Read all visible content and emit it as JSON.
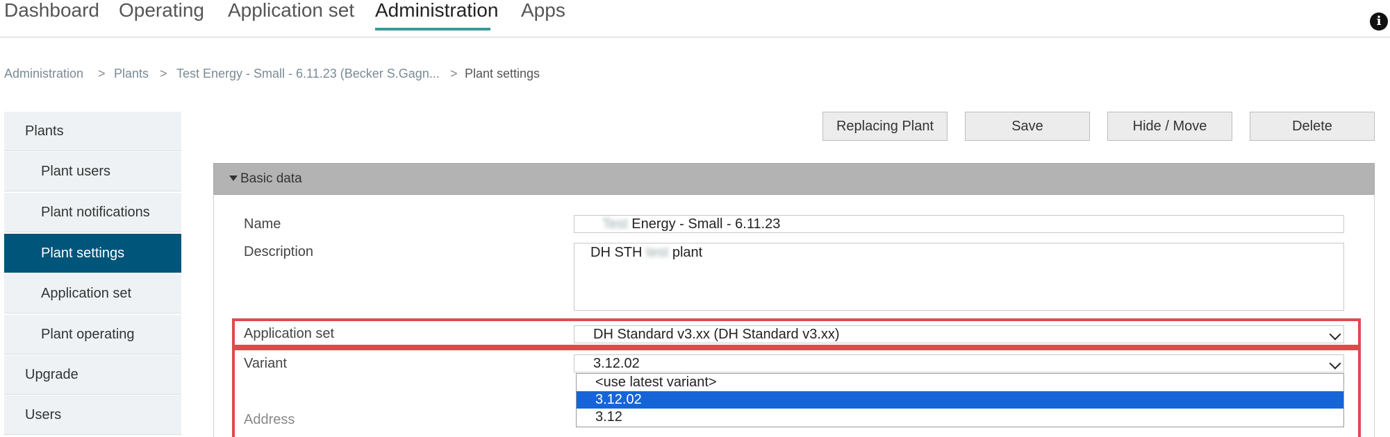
{
  "nav": {
    "tabs": [
      {
        "label": "Dashboard"
      },
      {
        "label": "Operating"
      },
      {
        "label": "Application set"
      },
      {
        "label": "Administration"
      },
      {
        "label": "Apps"
      }
    ],
    "active_tab": "Administration",
    "info_icon": "info-icon",
    "accent_color": "#3a9a97"
  },
  "breadcrumb": {
    "items": [
      "Administration",
      "Plants",
      "Test Energy - Small - 6.11.23 (Becker S.Gagn...",
      "Plant settings"
    ],
    "separator": ">"
  },
  "sidebar": {
    "items": [
      {
        "label": "Plants",
        "level": "top"
      },
      {
        "label": "Plant users",
        "level": "sub"
      },
      {
        "label": "Plant notifications",
        "level": "sub"
      },
      {
        "label": "Plant settings",
        "level": "sub",
        "active": true
      },
      {
        "label": "Application set",
        "level": "sub"
      },
      {
        "label": "Plant operating",
        "level": "sub"
      },
      {
        "label": "Upgrade",
        "level": "top"
      },
      {
        "label": "Users",
        "level": "top"
      }
    ],
    "active_color": "#00557a"
  },
  "toolbar": {
    "replacing_plant": "Replacing Plant",
    "save": "Save",
    "hide_move": "Hide / Move",
    "delete": "Delete"
  },
  "panel": {
    "title": "Basic data",
    "fields": {
      "name_label": "Name",
      "name_prefix": "Test",
      "name_value": "Energy - Small - 6.11.23",
      "description_label": "Description",
      "description_pre": "DH STH",
      "description_blur": "test",
      "description_post": "plant",
      "application_set_label": "Application set",
      "application_set_value": "DH Standard v3.xx (DH Standard v3.xx)",
      "variant_label": "Variant",
      "variant_value": "3.12.02",
      "address_label": "Address"
    },
    "variant_options": [
      "<use latest variant>",
      "3.12.02",
      "3.12"
    ],
    "variant_selected": "3.12.02",
    "highlight_color": "#e04a4f",
    "selected_option_color": "#1565d8"
  }
}
